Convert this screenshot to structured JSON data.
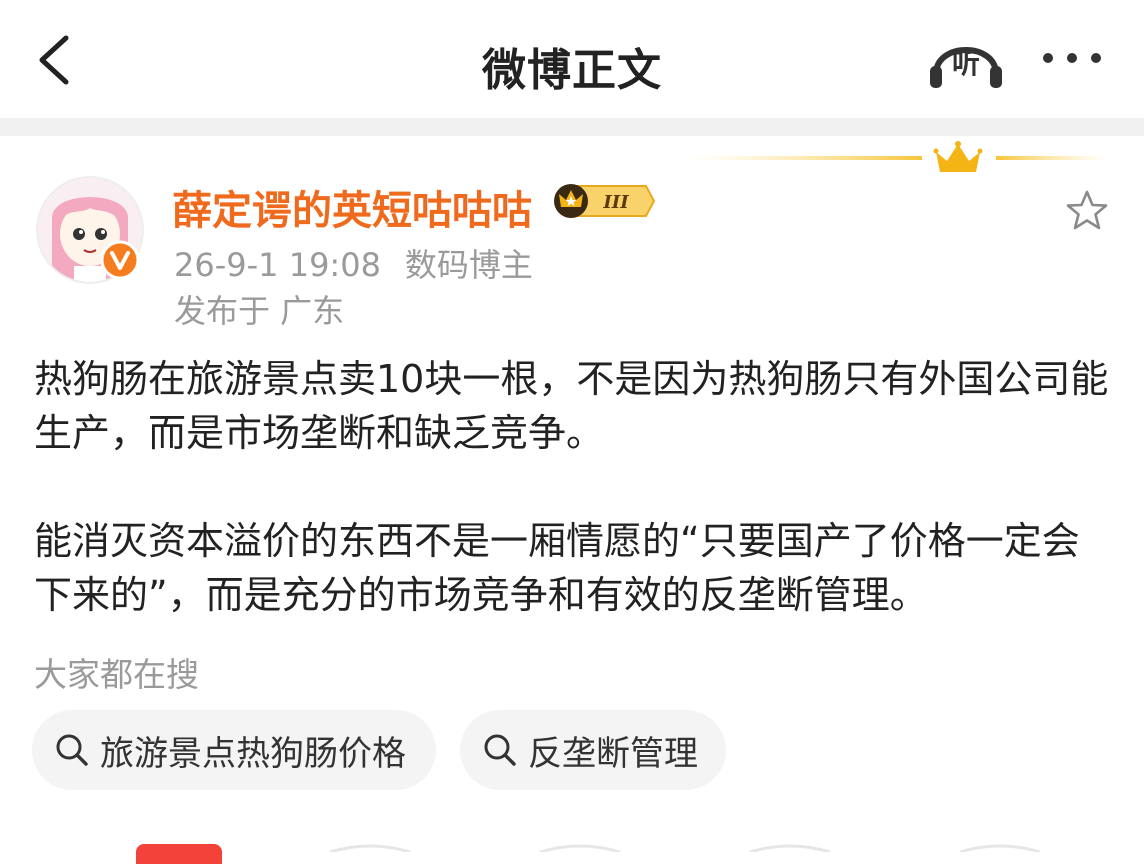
{
  "header": {
    "title": "微博正文",
    "listen_label": "听"
  },
  "post": {
    "author": "薛定谔的英短咕咕咕",
    "level_badge": "III",
    "timestamp": "26-9-1 19:08",
    "author_tag": "数码博主",
    "location": "发布于 广东",
    "paragraphs": [
      "热狗肠在旅游景点卖10块一根，不是因为热狗肠只有外国公司能生产，而是市场垄断和缺乏竞争。",
      "能消灭资本溢价的东西不是一厢情愿的“只要国产了价格一定会下来的”，而是充分的市场竞争和有效的反垄断管理。"
    ]
  },
  "search": {
    "hint": "大家都在搜",
    "chips": [
      "旅游景点热狗肠价格",
      "反垄断管理"
    ]
  },
  "colors": {
    "accent_orange": "#f06a1d",
    "vip_gold": "#f5b416",
    "verified_orange": "#f57d1f",
    "tag_red": "#f2423a"
  },
  "icons": [
    "back-arrow-icon",
    "headphones-icon",
    "more-dots-icon",
    "crown-icon",
    "verified-v-icon",
    "star-icon",
    "search-icon"
  ]
}
